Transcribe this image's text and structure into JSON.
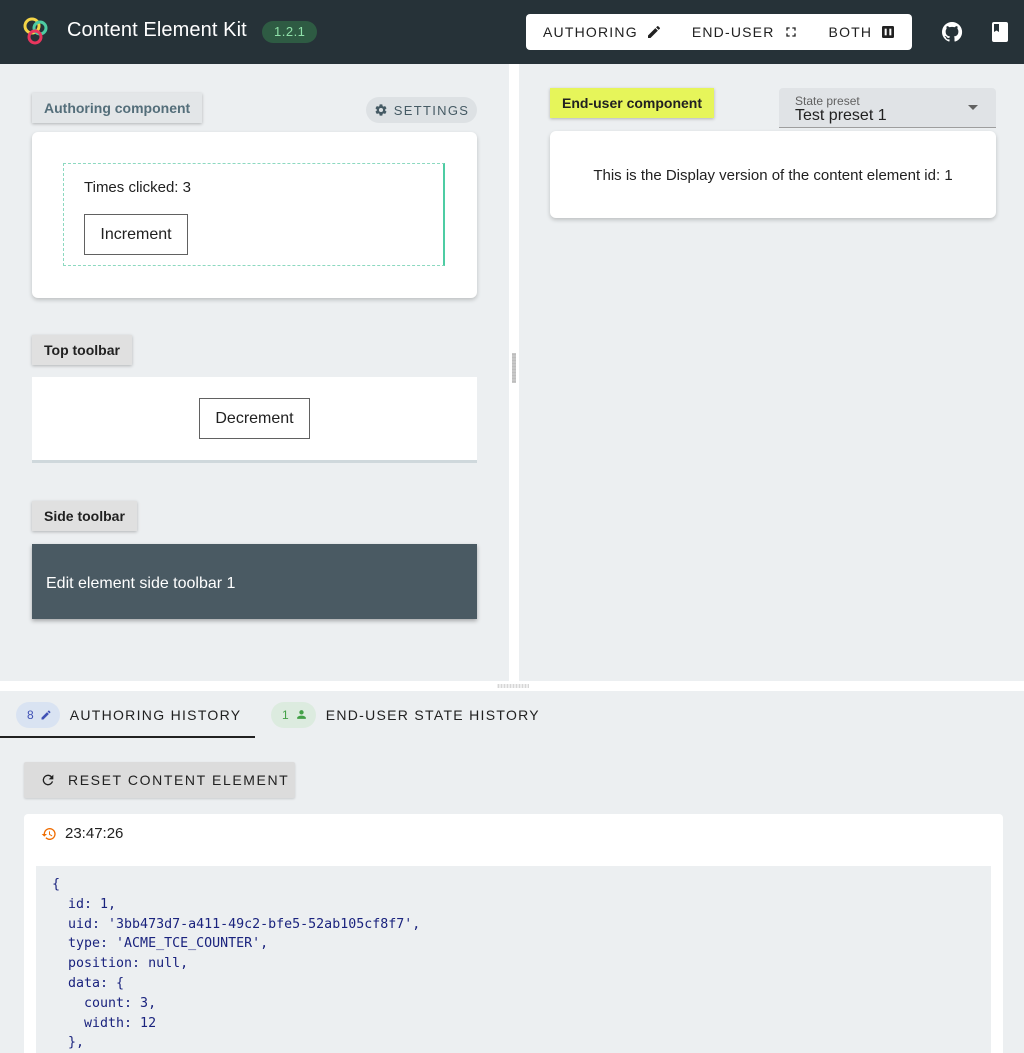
{
  "app": {
    "title": "Content Element Kit",
    "version": "1.2.1",
    "modes": [
      {
        "label": "AUTHORING",
        "icon": "pencil-icon"
      },
      {
        "label": "END-USER",
        "icon": "fullscreen-icon"
      },
      {
        "label": "BOTH",
        "icon": "columns-icon"
      }
    ],
    "icons": [
      "logo-icon",
      "github-icon",
      "book-icon"
    ]
  },
  "authoring": {
    "chip": "Authoring component",
    "settings_label": "SETTINGS",
    "times_clicked": "Times clicked: 3",
    "increment_label": "Increment"
  },
  "top_toolbar": {
    "chip": "Top toolbar",
    "decrement_label": "Decrement"
  },
  "side_toolbar": {
    "chip": "Side toolbar",
    "text": "Edit element side toolbar 1"
  },
  "end_user": {
    "chip": "End-user component",
    "state_preset_label": "State preset",
    "state_preset_value": "Test preset 1",
    "display_text": "This is the Display version of the content element id: 1"
  },
  "history": {
    "tabs": [
      {
        "count": "8",
        "label": "AUTHORING HISTORY"
      },
      {
        "count": "1",
        "label": "END-USER STATE HISTORY"
      }
    ],
    "reset_label": "RESET CONTENT ELEMENT",
    "timestamp": "23:47:26",
    "code_lines": [
      "{",
      "  id: 1,",
      "  uid: '3bb473d7-a411-49c2-bfe5-52ab105cf8f7',",
      "  type: 'ACME_TCE_COUNTER',",
      "  position: null,",
      "  data: {",
      "    count: 3,",
      "    width: 12",
      "  },"
    ]
  },
  "colors": {
    "appbar": "#263238",
    "accent_teal": "#4ecca3",
    "enduser_chip": "#e6f55a",
    "side_toolbar": "#4a5a63"
  }
}
